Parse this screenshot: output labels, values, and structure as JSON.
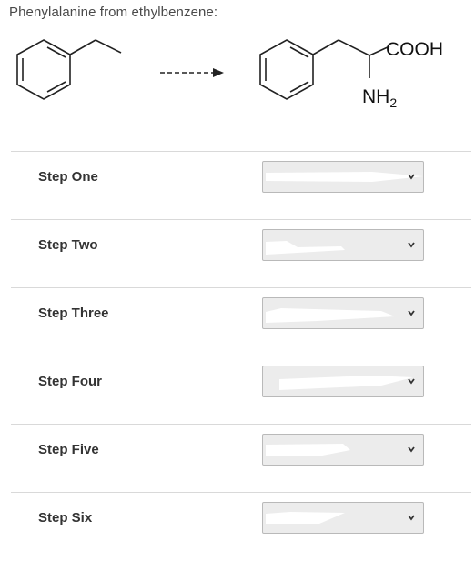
{
  "question": {
    "title": "Phenylalanine from ethylbenzene:"
  },
  "scheme": {
    "product_labels": {
      "carboxyl": "COOH",
      "amine_main": "NH",
      "amine_subscript": "2"
    }
  },
  "steps": [
    {
      "label": "Step One",
      "selected_value": ""
    },
    {
      "label": "Step Two",
      "selected_value": ""
    },
    {
      "label": "Step Three",
      "selected_value": ""
    },
    {
      "label": "Step Four",
      "selected_value": ""
    },
    {
      "label": "Step Five",
      "selected_value": ""
    },
    {
      "label": "Step Six",
      "selected_value": ""
    }
  ],
  "colors": {
    "select_bg": "#ececec",
    "select_border": "#b9b9b9",
    "divider": "#d9d9d9",
    "redaction": "#ffffff"
  },
  "icons": {
    "dropdown": "chevron-down-icon"
  }
}
